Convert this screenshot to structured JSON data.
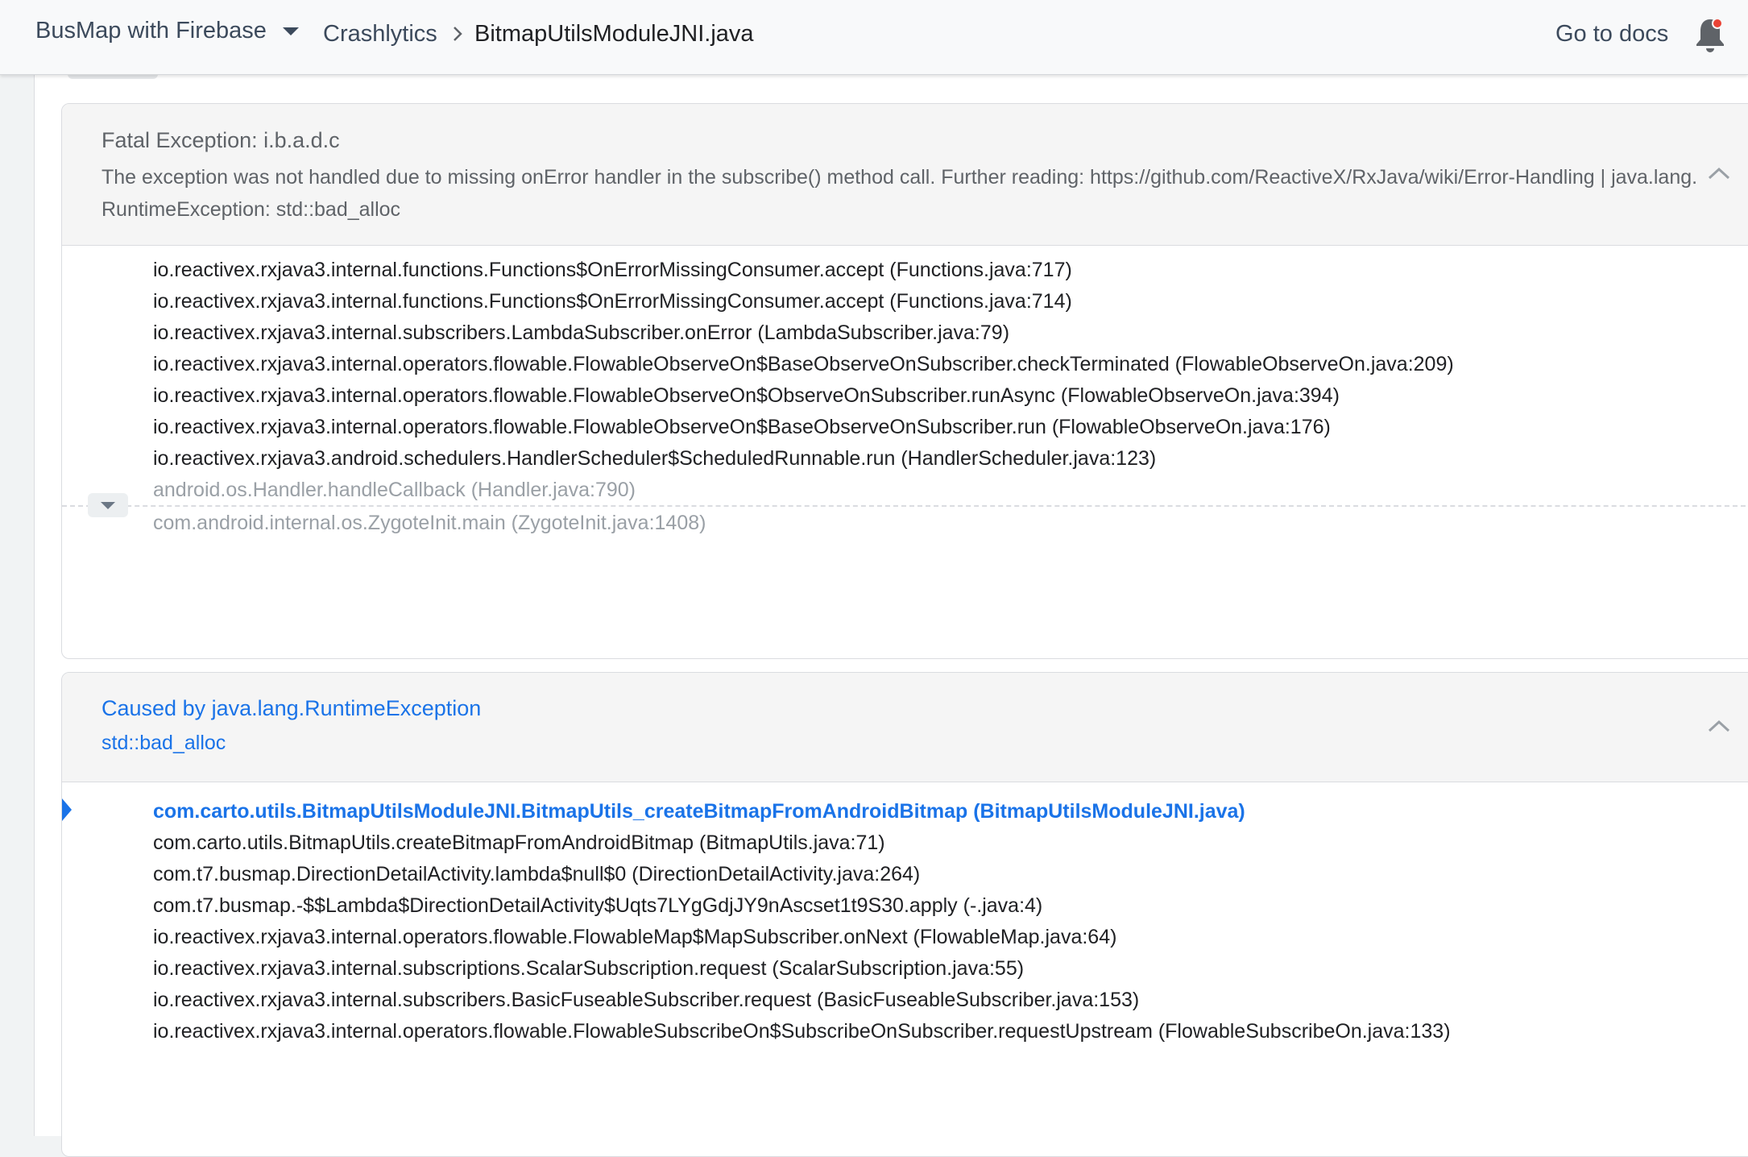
{
  "header": {
    "project": "BusMap with Firebase",
    "breadcrumb_section": "Crashlytics",
    "breadcrumb_current": "BitmapUtilsModuleJNI.java",
    "docs_link": "Go to docs",
    "icons": {
      "project_menu": "chevron-down-icon",
      "breadcrumb_sep": "chevron-right-icon",
      "notifications": "bell-icon"
    },
    "colors": {
      "notification_dot": "#ea4335"
    }
  },
  "exception": {
    "title": "Fatal Exception: i.b.a.d.c",
    "description": "The exception was not handled due to missing onError handler in the subscribe() method call. Further reading: https://github.com/ReactiveX/RxJava/wiki/Error-Handling | java.lang.RuntimeException: std::bad_alloc",
    "frames": [
      "io.reactivex.rxjava3.internal.functions.Functions$OnErrorMissingConsumer.accept (Functions.java:717)",
      "io.reactivex.rxjava3.internal.functions.Functions$OnErrorMissingConsumer.accept (Functions.java:714)",
      "io.reactivex.rxjava3.internal.subscribers.LambdaSubscriber.onError (LambdaSubscriber.java:79)",
      "io.reactivex.rxjava3.internal.operators.flowable.FlowableObserveOn$BaseObserveOnSubscriber.checkTerminated (FlowableObserveOn.java:209)",
      "io.reactivex.rxjava3.internal.operators.flowable.FlowableObserveOn$ObserveOnSubscriber.runAsync (FlowableObserveOn.java:394)",
      "io.reactivex.rxjava3.internal.operators.flowable.FlowableObserveOn$BaseObserveOnSubscriber.run (FlowableObserveOn.java:176)",
      "io.reactivex.rxjava3.android.schedulers.HandlerScheduler$ScheduledRunnable.run (HandlerScheduler.java:123)",
      "android.os.Handler.handleCallback (Handler.java:790)",
      "com.android.internal.os.ZygoteInit.main (ZygoteInit.java:1408)"
    ]
  },
  "cause": {
    "title": "Caused by java.lang.RuntimeException",
    "description": "std::bad_alloc",
    "frames": [
      "com.carto.utils.BitmapUtilsModuleJNI.BitmapUtils_createBitmapFromAndroidBitmap (BitmapUtilsModuleJNI.java)",
      "com.carto.utils.BitmapUtils.createBitmapFromAndroidBitmap (BitmapUtils.java:71)",
      "com.t7.busmap.DirectionDetailActivity.lambda$null$0 (DirectionDetailActivity.java:264)",
      "com.t7.busmap.-$$Lambda$DirectionDetailActivity$Uqts7LYgGdjJY9nAscset1t9S30.apply (-.java:4)",
      "io.reactivex.rxjava3.internal.operators.flowable.FlowableMap$MapSubscriber.onNext (FlowableMap.java:64)",
      "io.reactivex.rxjava3.internal.subscriptions.ScalarSubscription.request (ScalarSubscription.java:55)",
      "io.reactivex.rxjava3.internal.subscribers.BasicFuseableSubscriber.request (BasicFuseableSubscriber.java:153)",
      "io.reactivex.rxjava3.internal.operators.flowable.FlowableSubscribeOn$SubscribeOnSubscriber.requestUpstream (FlowableSubscribeOn.java:133)"
    ]
  }
}
